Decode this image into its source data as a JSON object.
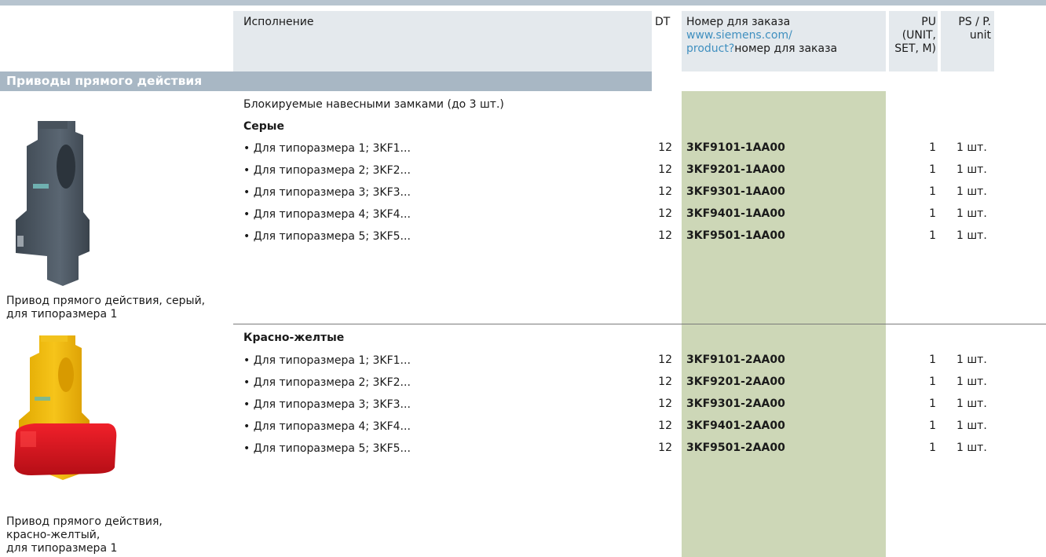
{
  "header": {
    "col_execution": "Исполнение",
    "col_dt": "DT",
    "col_order_line1": "Номер для заказа",
    "col_order_link1": "www.siemens.com/",
    "col_order_link2": "product?",
    "col_order_line3": "номер для заказа",
    "col_pu_line1": "PU",
    "col_pu_line2": "(UNIT,",
    "col_pu_line3": "SET, M)",
    "col_ps_line1": "PS / P.",
    "col_ps_line2": "unit"
  },
  "section": {
    "title": "Приводы прямого действия"
  },
  "group1": {
    "lockable_note": "Блокируемые навесными замками (до 3 шт.)",
    "subtitle": "Серые",
    "caption_line1": "Привод прямого действия, серый,",
    "caption_line2": "для типоразмера 1",
    "rows": [
      {
        "desc": "• Для типоразмера 1; 3KF1...",
        "dt": "12",
        "code": "3KF9101-1AA00",
        "pu": "1",
        "ps": "1 шт."
      },
      {
        "desc": "• Для типоразмера 2; 3KF2...",
        "dt": "12",
        "code": "3KF9201-1AA00",
        "pu": "1",
        "ps": "1 шт."
      },
      {
        "desc": "• Для типоразмера 3; 3KF3...",
        "dt": "12",
        "code": "3KF9301-1AA00",
        "pu": "1",
        "ps": "1 шт."
      },
      {
        "desc": "• Для типоразмера 4; 3KF4...",
        "dt": "12",
        "code": "3KF9401-1AA00",
        "pu": "1",
        "ps": "1 шт."
      },
      {
        "desc": "• Для типоразмера 5; 3KF5...",
        "dt": "12",
        "code": "3KF9501-1AA00",
        "pu": "1",
        "ps": "1 шт."
      }
    ]
  },
  "group2": {
    "subtitle": "Красно-желтые",
    "caption_line1": "Привод прямого действия,",
    "caption_line2": "красно-желтый,",
    "caption_line3": "для типоразмера 1",
    "rows": [
      {
        "desc": "• Для типоразмера 1; 3KF1...",
        "dt": "12",
        "code": "3KF9101-2AA00",
        "pu": "1",
        "ps": "1 шт."
      },
      {
        "desc": "• Для типоразмера 2; 3KF2...",
        "dt": "12",
        "code": "3KF9201-2AA00",
        "pu": "1",
        "ps": "1 шт."
      },
      {
        "desc": "• Для типоразмера 3; 3KF3...",
        "dt": "12",
        "code": "3KF9301-2AA00",
        "pu": "1",
        "ps": "1 шт."
      },
      {
        "desc": "• Для типоразмера 4; 3KF4...",
        "dt": "12",
        "code": "3KF9401-2AA00",
        "pu": "1",
        "ps": "1 шт."
      },
      {
        "desc": "• Для типоразмера 5; 3KF5...",
        "dt": "12",
        "code": "3KF9501-2AA00",
        "pu": "1",
        "ps": "1 шт."
      }
    ]
  },
  "colors": {
    "header_bg": "#e4e9ed",
    "section_bar": "#a8b7c4",
    "order_column": "#cdd7b7",
    "link": "#3f8fbf"
  }
}
